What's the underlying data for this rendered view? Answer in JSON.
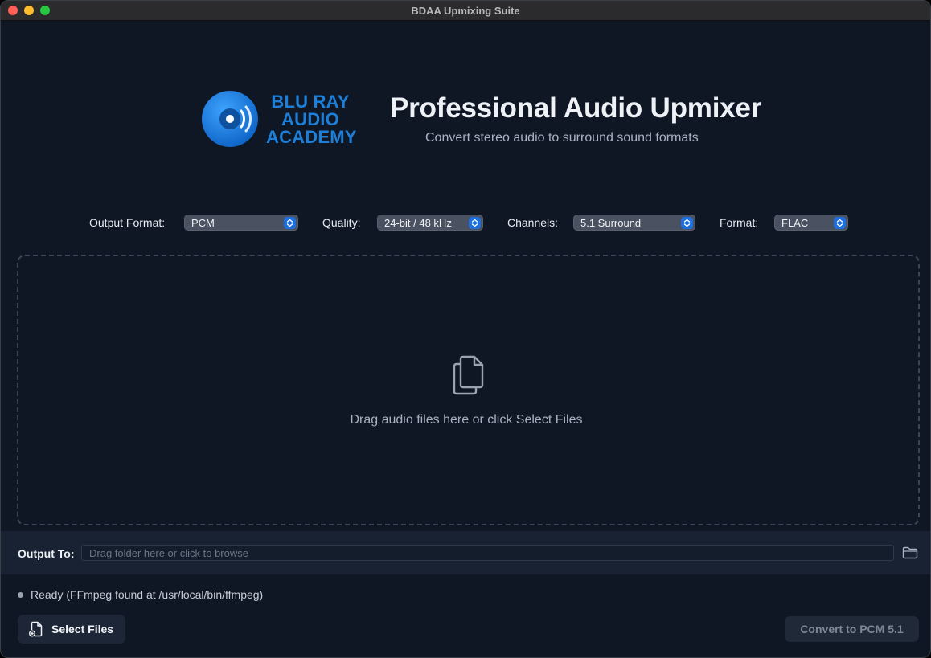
{
  "window": {
    "title": "BDAA Upmixing Suite"
  },
  "header": {
    "logo_lines": [
      "BLU RAY",
      "AUDIO",
      "ACADEMY"
    ],
    "title": "Professional Audio Upmixer",
    "subtitle": "Convert stereo audio to surround sound formats",
    "brand_color": "#1e7fd8"
  },
  "settings": {
    "output_format": {
      "label": "Output Format:",
      "value": "PCM"
    },
    "quality": {
      "label": "Quality:",
      "value": "24-bit / 48 kHz"
    },
    "channels": {
      "label": "Channels:",
      "value": "5.1 Surround"
    },
    "format": {
      "label": "Format:",
      "value": "FLAC"
    }
  },
  "dropzone": {
    "icon": "documents-icon",
    "text": "Drag audio files here or click Select Files"
  },
  "output": {
    "label": "Output To:",
    "placeholder": "Drag folder here or click to browse",
    "value": "",
    "browse_icon": "folder-icon"
  },
  "status": {
    "text": "Ready (FFmpeg found at /usr/local/bin/ffmpeg)"
  },
  "buttons": {
    "select_files": "Select Files",
    "convert": "Convert to PCM 5.1"
  },
  "colors": {
    "background": "#0f1725",
    "accent": "#1d6fe0"
  }
}
